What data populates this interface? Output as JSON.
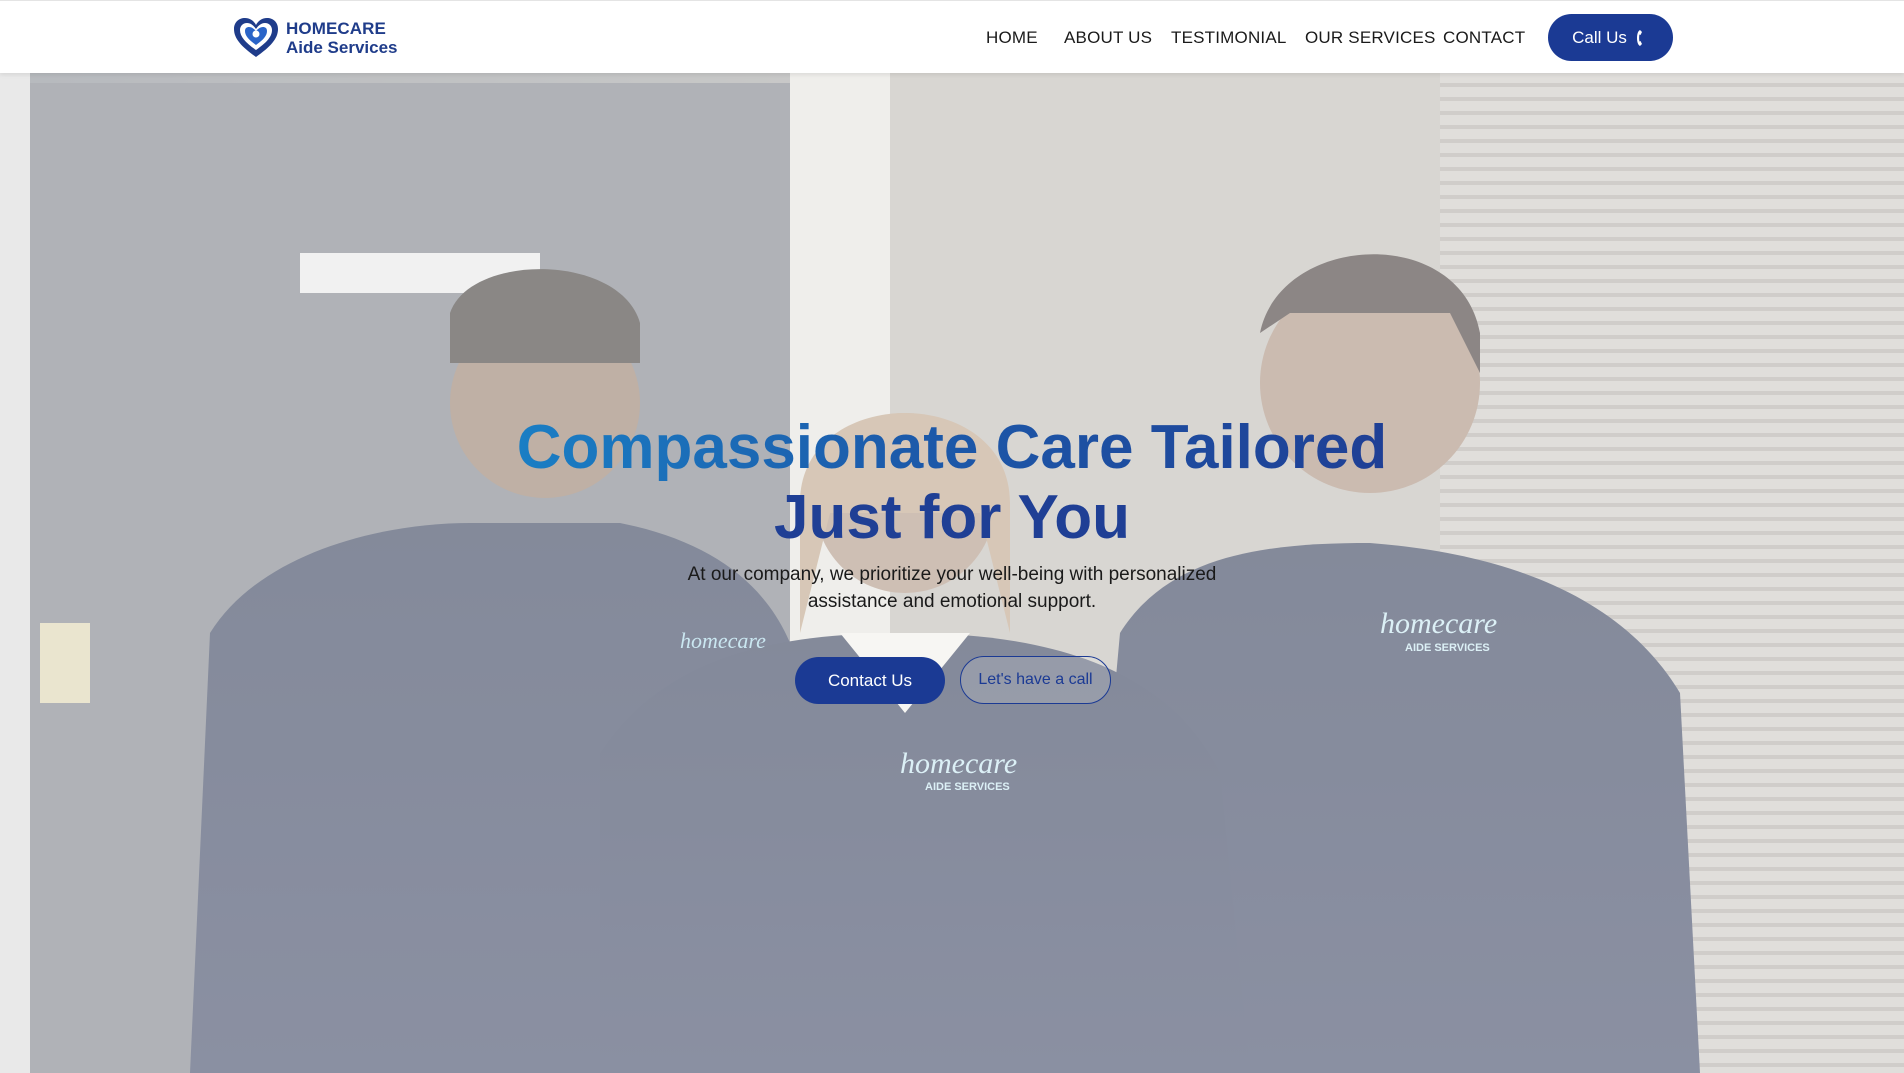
{
  "brand": {
    "line1": "HOMECARE",
    "line2": "Aide Services",
    "logo_icon": "heart-hands-icon",
    "color": "#1f3c8a"
  },
  "nav": {
    "items": [
      {
        "label": "HOME"
      },
      {
        "label": "ABOUT US"
      },
      {
        "label": "TESTIMONIAL"
      },
      {
        "label": "OUR SERVICES"
      },
      {
        "label": "CONTACT"
      }
    ],
    "call_label": "Call Us",
    "call_icon": "phone-icon"
  },
  "hero": {
    "title_line1": "Compassionate Care Tailored",
    "title_line2": "Just for You",
    "subtitle_line1": "At our company, we prioritize your well-being with personalized",
    "subtitle_line2": "assistance and emotional support.",
    "primary_button": "Contact Us",
    "secondary_button": "Let's have a call",
    "shirt_logo_text1": "homecare",
    "shirt_logo_text2": "AIDE SERVICES"
  },
  "colors": {
    "primary": "#1b3a94",
    "title_gradient_start": "#1a7ec4",
    "title_gradient_end": "#1f3f95"
  }
}
